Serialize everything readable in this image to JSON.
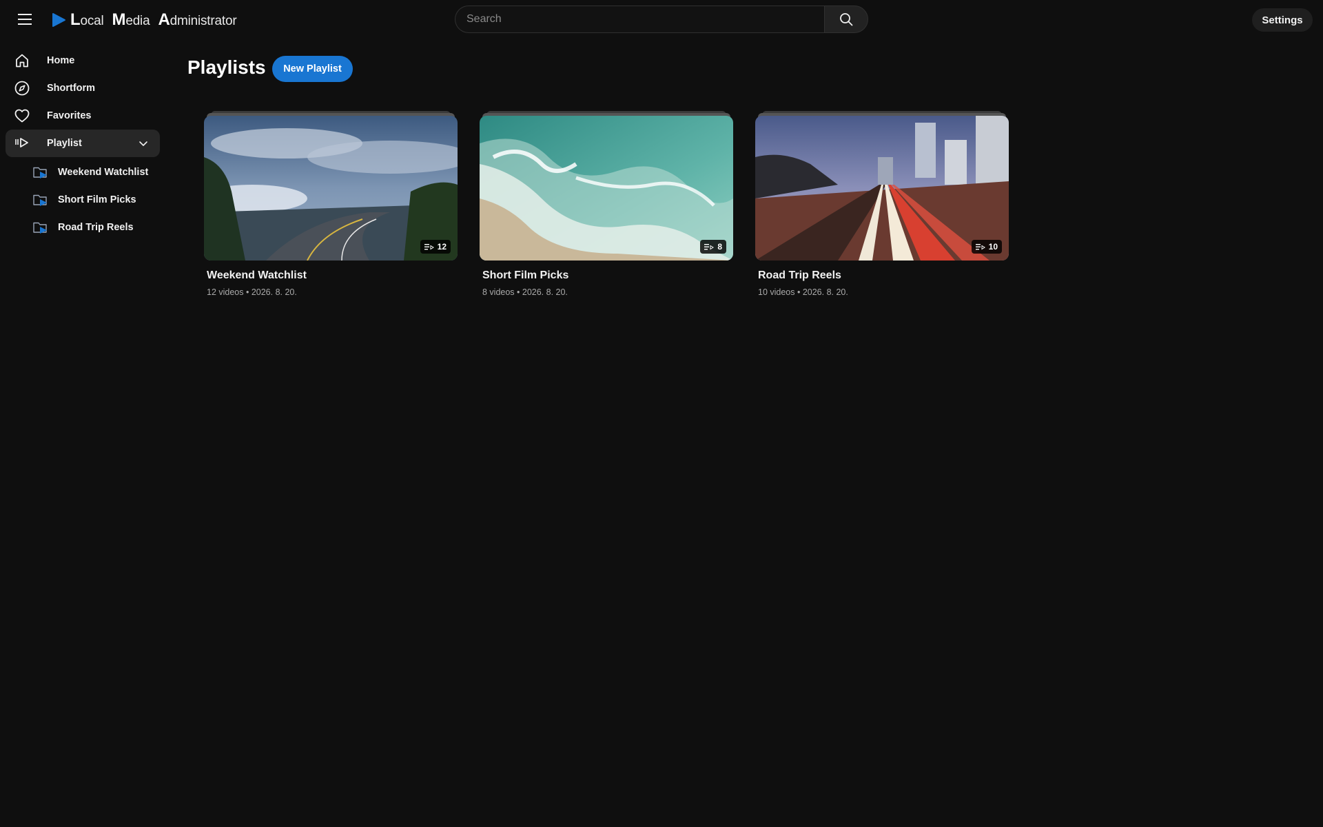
{
  "header": {
    "menu_icon": "hamburger-icon",
    "logo": {
      "icon": "play-icon",
      "word1_initial": "L",
      "word1_rest": "ocal",
      "word2_initial": "M",
      "word2_rest": "edia",
      "word3_initial": "A",
      "word3_rest": "dministrator",
      "accent_color": "#1976d2"
    },
    "search_placeholder": "Search",
    "search_icon": "search-icon",
    "settings_label": "Settings"
  },
  "sidebar": {
    "items": [
      {
        "label": "Home",
        "icon": "home-icon"
      },
      {
        "label": "Shortform",
        "icon": "compass-icon"
      },
      {
        "label": "Favorites",
        "icon": "heart-icon"
      },
      {
        "label": "Playlist",
        "icon": "playlist-icon",
        "expanded": true
      }
    ],
    "playlists": [
      {
        "label": "Weekend Watchlist",
        "icon": "folder-play-icon"
      },
      {
        "label": "Short Film Picks",
        "icon": "folder-play-icon"
      },
      {
        "label": "Road Trip Reels",
        "icon": "folder-play-icon"
      }
    ]
  },
  "main": {
    "title": "Playlists",
    "new_button_label": "New Playlist",
    "cards": [
      {
        "title": "Weekend Watchlist",
        "count": "12",
        "meta": "12 videos • 2026. 8. 20.",
        "thumb": "cloudy-road"
      },
      {
        "title": "Short Film Picks",
        "count": "8",
        "meta": "8 videos • 2026. 8. 20.",
        "thumb": "ocean-waves"
      },
      {
        "title": "Road Trip Reels",
        "count": "10",
        "meta": "10 videos • 2026. 8. 20.",
        "thumb": "city-traffic-night"
      }
    ]
  },
  "colors": {
    "background": "#0f0f0f",
    "accent": "#1976d2",
    "active_nav": "#272727"
  }
}
